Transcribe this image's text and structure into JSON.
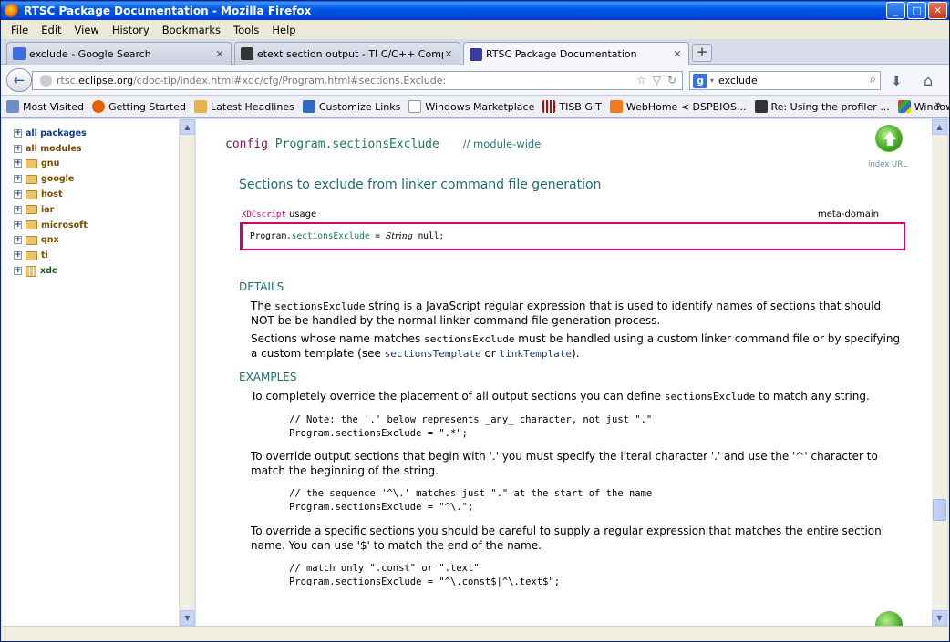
{
  "window": {
    "title": "RTSC Package Documentation - Mozilla Firefox"
  },
  "menu": [
    "File",
    "Edit",
    "View",
    "History",
    "Bookmarks",
    "Tools",
    "Help"
  ],
  "tabs": [
    {
      "label": "exclude - Google Search",
      "close": "✕"
    },
    {
      "label": "etext section output - TI C/C++ Compile...",
      "close": "✕"
    },
    {
      "label": "RTSC Package Documentation",
      "close": "✕"
    }
  ],
  "newtab": "+",
  "nav": {
    "url_prefix": "rtsc.",
    "url_domain": "eclipse.org",
    "url_rest": "/cdoc-tip/index.html#xdc/cfg/Program.html#sections.Exclude:",
    "search_value": "exclude"
  },
  "bookmarks": [
    "Most Visited",
    "Getting Started",
    "Latest Headlines",
    "Customize Links",
    "Windows Marketplace",
    "TISB GIT",
    "WebHome < DSPBIOS...",
    "Re: Using the profiler ...",
    "Windows Media"
  ],
  "sidebar": {
    "tree": [
      "all packages",
      "all modules",
      "gnu",
      "google",
      "host",
      "iar",
      "microsoft",
      "qnx",
      "ti",
      "xdc"
    ]
  },
  "content": {
    "config_kw": "config",
    "config_name": "Program.sectionsExclude",
    "scope": "// module-wide",
    "index_url": "index URL",
    "summary": "Sections to exclude from linker command file generation",
    "usage_xdc": "XDCscript",
    "usage_label": "usage",
    "meta_domain": "meta-domain",
    "code_obj": "Program.",
    "code_prop": "sectionsExclude",
    "code_eq": " = ",
    "code_type": "String",
    "code_val": " null;",
    "details_hdr": "DETAILS",
    "d1_a": "The ",
    "d1_code": "sectionsExclude",
    "d1_b": " string is a JavaScript regular expression that is used to identify names of sections that should NOT be be handled by the normal linker command file generation process.",
    "d2_a": "Sections whose name matches ",
    "d2_code": "sectionsExclude",
    "d2_b": " must be handled using a custom linker command file or by specifying a custom template (see ",
    "d2_link1": "sectionsTemplate",
    "d2_or": " or ",
    "d2_link2": "linkTemplate",
    "d2_end": ").",
    "examples_hdr": "EXAMPLES",
    "e1_a": "To completely override the placement of all output sections you can define ",
    "e1_code": "sectionsExclude",
    "e1_b": " to match any string.",
    "c1": "// Note: the '.' below represents _any_ character, not just \".\"\nProgram.sectionsExclude = \".*\";",
    "e2": "To override output sections that begin with '.' you must specify the literal character '.' and use the '^' character to match the beginning of the string.",
    "c2": "// the sequence '^\\.' matches just \".\" at the start of the name\nProgram.sectionsExclude = \"^\\.\";",
    "e3": "To override a specific sections you should be careful to supply a regular expression that matches the entire section name. You can use '$' to match the end of the name.",
    "c3": "// match only \".const\" or \".text\"\nProgram.sectionsExclude = \"^\\.const$|^\\.text$\";"
  }
}
